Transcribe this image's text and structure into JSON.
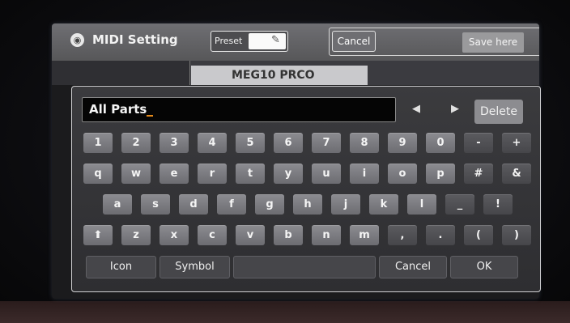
{
  "app": {
    "title": "MIDI Setting",
    "preset_label": "Preset",
    "cancel_label": "Cancel",
    "save_label": "Save here"
  },
  "background_item": {
    "label": "MEG10 PRCO"
  },
  "keyboard": {
    "input_value": "All Parts",
    "delete_label": "Delete",
    "row1": [
      "1",
      "2",
      "3",
      "4",
      "5",
      "6",
      "7",
      "8",
      "9",
      "0",
      "-",
      "+"
    ],
    "row2": [
      "q",
      "w",
      "e",
      "r",
      "t",
      "y",
      "u",
      "i",
      "o",
      "p",
      "#",
      "&"
    ],
    "row3": [
      "a",
      "s",
      "d",
      "f",
      "g",
      "h",
      "j",
      "k",
      "l",
      "_",
      "!"
    ],
    "row4": [
      "z",
      "x",
      "c",
      "v",
      "b",
      "n",
      "m",
      ",",
      ".",
      "(",
      ")"
    ],
    "icon_label": "Icon",
    "symbol_label": "Symbol",
    "space_label": "",
    "cancel_label": "Cancel",
    "ok_label": "OK"
  },
  "colors": {
    "accent_caret": "#e58a1a",
    "key": "#7c7c81",
    "dialog_border": "#d0d0d2"
  }
}
